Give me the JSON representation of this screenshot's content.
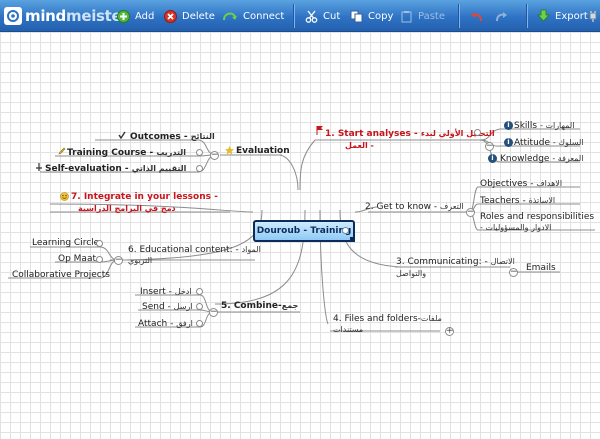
{
  "app": {
    "logo_part1": "mind",
    "logo_part2": "meister"
  },
  "toolbar": {
    "add": "Add",
    "delete": "Delete",
    "connect": "Connect",
    "cut": "Cut",
    "copy": "Copy",
    "paste": "Paste",
    "export": "Export"
  },
  "colors": {
    "toolbar_blue": "#2f73c4",
    "accent_red": "#c8151b",
    "central_border": "#0b2c5a",
    "link_gray": "#8c8c8c"
  },
  "map": {
    "central": "Douroub - Training",
    "n1": {
      "label": "1. Start analyses -",
      "ar": "التحليل الأولي لبدء",
      "ar2": "العمل -"
    },
    "skills": {
      "label": "Skills",
      "ar": "- المهارات"
    },
    "attitude": {
      "label": "Attitude",
      "ar": "- السلوك"
    },
    "knowledge": {
      "label": "Knowledge",
      "ar": "- المعرفة"
    },
    "evaluation": {
      "label": "Evaluation"
    },
    "outcomes": {
      "label": "Outcomes -",
      "ar": "النتائج"
    },
    "training_course": {
      "label": "Training Course -",
      "ar": "التدريب"
    },
    "self_eval": {
      "label": "Self-evaluation -",
      "ar": "التقييم الذاتي"
    },
    "n7": {
      "label": "7. Integrate in your lessons -",
      "ar": "دمج في البرامج الدراسية"
    },
    "n2": {
      "label": "2. Get to know -",
      "ar": "التعرف"
    },
    "objectives": {
      "label": "Objectives -",
      "ar": "الاهداف"
    },
    "teachers": {
      "label": "Teachers -",
      "ar": "الاساتذة"
    },
    "roles": {
      "label": "Roles and responsibilities",
      "ar": "- الادوار والمسؤوليات"
    },
    "n6": {
      "label": "6. Educational content: -",
      "ar": "المواد",
      "ar2": "التربوي"
    },
    "learning_circle": {
      "label": "Learning Circle"
    },
    "op_maat": {
      "label": "Op Maat"
    },
    "collab": {
      "label": "Collaborative Projects"
    },
    "n3": {
      "label": "3. Communicating: -",
      "ar": "الاتصال",
      "ar2": "والتواصل"
    },
    "emails": {
      "label": "Emails"
    },
    "n5": {
      "label": "5. Combine-",
      "ar": "جمع"
    },
    "insert": {
      "label": "Insert -",
      "ar": "ادخل"
    },
    "send": {
      "label": "Send -",
      "ar": "ارسل"
    },
    "attach": {
      "label": "Attach -",
      "ar": "ارفق"
    },
    "n4": {
      "label": "4. Files and folders-",
      "ar": "ملفات",
      "ar2": "مستندات"
    }
  }
}
